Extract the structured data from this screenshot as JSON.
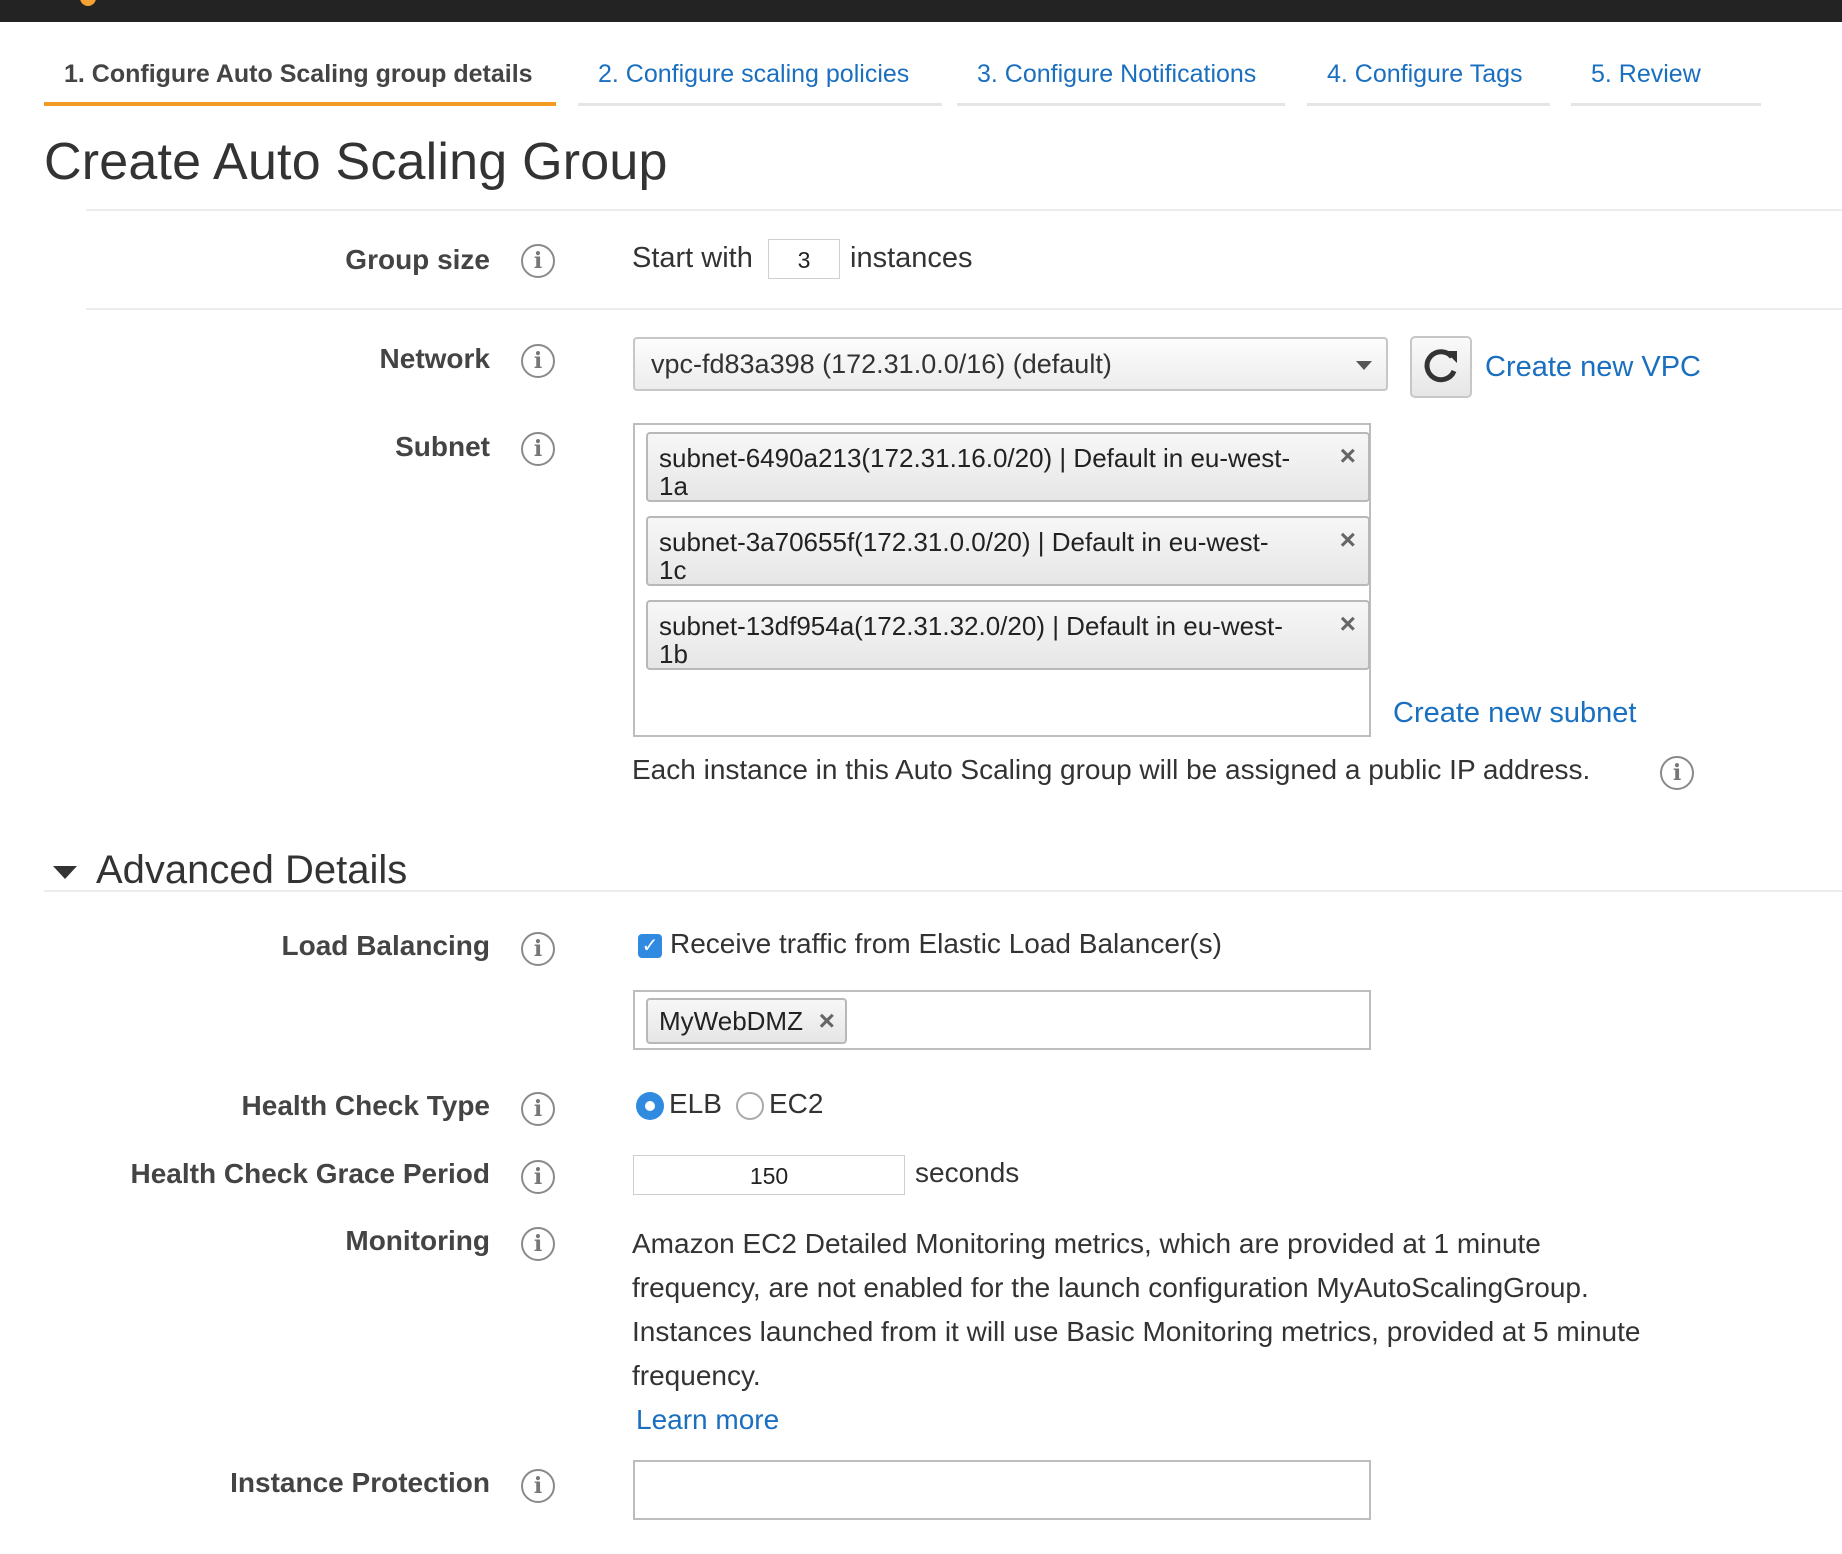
{
  "tabs": [
    {
      "label": "1. Configure Auto Scaling group details",
      "active": true
    },
    {
      "label": "2. Configure scaling policies",
      "active": false
    },
    {
      "label": "3. Configure Notifications",
      "active": false
    },
    {
      "label": "4. Configure Tags",
      "active": false
    },
    {
      "label": "5. Review",
      "active": false
    }
  ],
  "page_title": "Create Auto Scaling Group",
  "group_size": {
    "label": "Group size",
    "prefix": "Start with",
    "value": "3",
    "suffix": "instances"
  },
  "network": {
    "label": "Network",
    "selected": "vpc-fd83a398 (172.31.0.0/16) (default)",
    "create_link": "Create new VPC"
  },
  "subnet": {
    "label": "Subnet",
    "chips": [
      {
        "line1": "subnet-6490a213(172.31.16.0/20) | Default in eu-west-",
        "line2": "1a"
      },
      {
        "line1": "subnet-3a70655f(172.31.0.0/20) | Default in eu-west-",
        "line2": "1c"
      },
      {
        "line1": "subnet-13df954a(172.31.32.0/20) | Default in eu-west-",
        "line2": "1b"
      }
    ],
    "create_link": "Create new subnet",
    "public_ip_note": "Each instance in this Auto Scaling group will be assigned a public IP address."
  },
  "advanced": {
    "title": "Advanced Details"
  },
  "load_balancing": {
    "label": "Load Balancing",
    "checkbox_label": "Receive traffic from Elastic Load Balancer(s)",
    "checked": true,
    "balancer": "MyWebDMZ"
  },
  "health_check_type": {
    "label": "Health Check Type",
    "options": [
      "ELB",
      "EC2"
    ],
    "selected": "ELB"
  },
  "grace_period": {
    "label": "Health Check Grace Period",
    "value": "150",
    "unit": "seconds"
  },
  "monitoring": {
    "label": "Monitoring",
    "lines": [
      "Amazon EC2 Detailed Monitoring metrics, which are provided at 1 minute",
      "frequency, are not enabled for the launch configuration MyAutoScalingGroup.",
      "Instances launched from it will use Basic Monitoring metrics, provided at 5 minute",
      "frequency."
    ],
    "learn_more": "Learn more"
  },
  "instance_protection": {
    "label": "Instance Protection",
    "value": ""
  },
  "icons": {
    "info": "i",
    "close": "×",
    "check": "✓"
  },
  "colors": {
    "accent": "#f39a25",
    "link": "#1a6fbf",
    "checkbox": "#2f8ae0"
  }
}
